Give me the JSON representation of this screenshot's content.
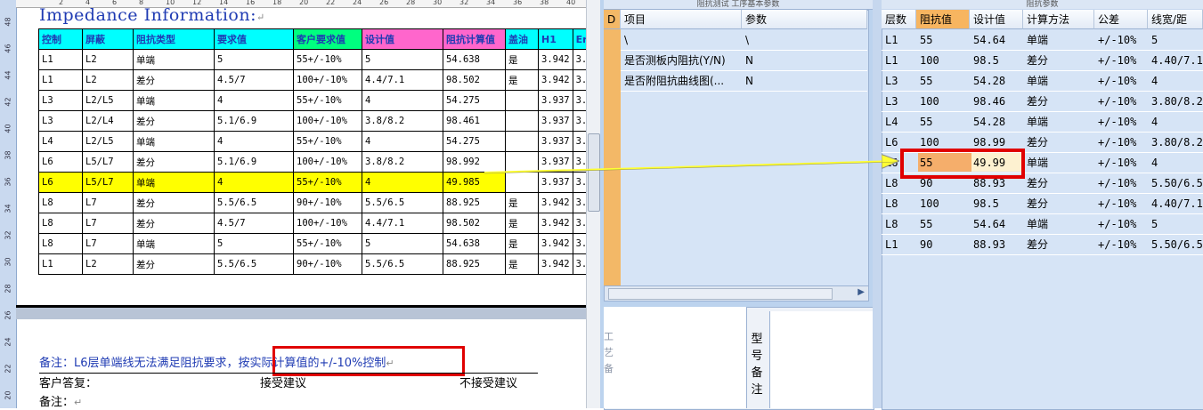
{
  "doc": {
    "title": "Impedance Information:",
    "ruler_numbers": [
      "2",
      "4",
      "6",
      "8",
      "10",
      "12",
      "14",
      "16",
      "18",
      "20",
      "22",
      "24",
      "26",
      "28",
      "30",
      "32",
      "34",
      "36",
      "38",
      "40"
    ],
    "vruler_numbers": [
      "48",
      "46",
      "44",
      "42",
      "40",
      "38",
      "36",
      "34",
      "32",
      "30",
      "28",
      "26",
      "24",
      "22",
      "20"
    ],
    "table_headers": [
      "控制",
      "屏蔽",
      "阻抗类型",
      "要求值",
      "客户要求值",
      "设计值",
      "阻抗计算值",
      "盖油",
      "H1",
      "Er"
    ],
    "table_rows": [
      [
        "L1",
        "L2",
        "单端",
        "5",
        "55+/-10%",
        "5",
        "54.638",
        "是",
        "3.942",
        "3."
      ],
      [
        "L1",
        "L2",
        "差分",
        "4.5/7",
        "100+/-10%",
        "4.4/7.1",
        "98.502",
        "是",
        "3.942",
        "3."
      ],
      [
        "L3",
        "L2/L5",
        "单端",
        "4",
        "55+/-10%",
        "4",
        "54.275",
        "",
        "3.937",
        "3."
      ],
      [
        "L3",
        "L2/L4",
        "差分",
        "5.1/6.9",
        "100+/-10%",
        "3.8/8.2",
        "98.461",
        "",
        "3.937",
        "3."
      ],
      [
        "L4",
        "L2/L5",
        "单端",
        "4",
        "55+/-10%",
        "4",
        "54.275",
        "",
        "3.937",
        "3."
      ],
      [
        "L6",
        "L5/L7",
        "差分",
        "5.1/6.9",
        "100+/-10%",
        "3.8/8.2",
        "98.992",
        "",
        "3.937",
        "3."
      ],
      [
        "L6",
        "L5/L7",
        "单端",
        "4",
        "55+/-10%",
        "4",
        "49.985",
        "",
        "3.937",
        "3."
      ],
      [
        "L8",
        "L7",
        "差分",
        "5.5/6.5",
        "90+/-10%",
        "5.5/6.5",
        "88.925",
        "是",
        "3.942",
        "3."
      ],
      [
        "L8",
        "L7",
        "差分",
        "4.5/7",
        "100+/-10%",
        "4.4/7.1",
        "98.502",
        "是",
        "3.942",
        "3."
      ],
      [
        "L8",
        "L7",
        "单端",
        "5",
        "55+/-10%",
        "5",
        "54.638",
        "是",
        "3.942",
        "3."
      ],
      [
        "L1",
        "L2",
        "差分",
        "5.5/6.5",
        "90+/-10%",
        "5.5/6.5",
        "88.925",
        "是",
        "3.942",
        "3."
      ]
    ],
    "remark_prefix": "备注：L6层单端线无法满足阻抗要求，",
    "remark_boxed": "按实际计算值的+/-10%控制",
    "reply_label": "客户答复：",
    "accept": "接受建议",
    "reject": "不接受建议",
    "remark2": "备注："
  },
  "mid": {
    "top_title": "阻抗测试  工序基本参数",
    "headers": [
      "D",
      "项目",
      "参数"
    ],
    "rows": [
      [
        "\\",
        "\\"
      ],
      [
        "是否测板内阻抗(Y/N)",
        "N"
      ],
      [
        "是否附阻抗曲线图(...",
        "N"
      ]
    ],
    "vertical_text": [
      "型",
      "号",
      "备",
      "注"
    ],
    "faded_text": [
      "工",
      "艺",
      "备"
    ]
  },
  "right": {
    "top_title": "阻抗参数",
    "headers": [
      "层数",
      "阻抗值",
      "设计值",
      "计算方法",
      "公差",
      "线宽/距"
    ],
    "rows": [
      [
        "L1",
        "55",
        "54.64",
        "单端",
        "+/-10%",
        "5"
      ],
      [
        "L1",
        "100",
        "98.5",
        "差分",
        "+/-10%",
        "4.40/7.10"
      ],
      [
        "L3",
        "55",
        "54.28",
        "单端",
        "+/-10%",
        "4"
      ],
      [
        "L3",
        "100",
        "98.46",
        "差分",
        "+/-10%",
        "3.80/8.20"
      ],
      [
        "L4",
        "55",
        "54.28",
        "单端",
        "+/-10%",
        "4"
      ],
      [
        "L6",
        "100",
        "98.99",
        "差分",
        "+/-10%",
        "3.80/8.20"
      ],
      [
        "L6",
        "55",
        "49.99",
        "单端",
        "+/-10%",
        "4"
      ],
      [
        "L8",
        "90",
        "88.93",
        "差分",
        "+/-10%",
        "5.50/6.50"
      ],
      [
        "L8",
        "100",
        "98.5",
        "差分",
        "+/-10%",
        "4.40/7.10"
      ],
      [
        "L8",
        "55",
        "54.64",
        "单端",
        "+/-10%",
        "5"
      ],
      [
        "L1",
        "90",
        "88.93",
        "差分",
        "+/-10%",
        "5.50/6.50"
      ]
    ]
  },
  "colors": {
    "highlight_yellow": "#ffff00",
    "callout_red": "#e00000",
    "grid_blue": "#d6e4f6",
    "header_cyan": "#00ffff",
    "header_green": "#00ff7f",
    "header_magenta": "#ff66cc",
    "selected_orange": "#f5ae6b"
  }
}
